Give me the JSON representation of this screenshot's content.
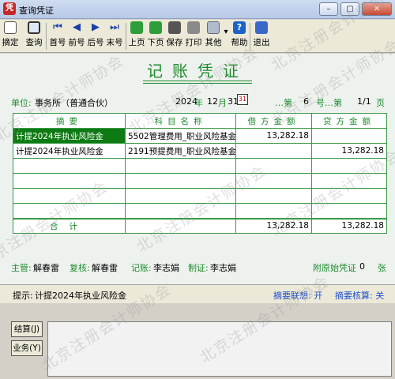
{
  "window": {
    "title": "查询凭证",
    "app_icon": "凭",
    "minimize_icon": "–",
    "maximize_icon": "▢",
    "close_icon": "✕"
  },
  "toolbar": {
    "items": [
      {
        "label": "摘定",
        "icon": "document-icon"
      },
      {
        "label": "查询",
        "icon": "search-icon"
      },
      {
        "label": "首号",
        "icon": "first-icon",
        "glyph": "⏮"
      },
      {
        "label": "前号",
        "icon": "prev-icon",
        "glyph": "◀"
      },
      {
        "label": "后号",
        "icon": "next-icon",
        "glyph": "▶"
      },
      {
        "label": "末号",
        "icon": "last-icon",
        "glyph": "⏭"
      },
      {
        "label": "上页",
        "icon": "page-up-icon"
      },
      {
        "label": "下页",
        "icon": "page-down-icon"
      },
      {
        "label": "保存",
        "icon": "save-icon"
      },
      {
        "label": "打印",
        "icon": "print-icon"
      },
      {
        "label": "其他",
        "icon": "other-icon",
        "dropdown": "▾"
      },
      {
        "label": "帮助",
        "icon": "help-icon",
        "glyph": "?"
      },
      {
        "label": "退出",
        "icon": "exit-icon"
      }
    ]
  },
  "voucher": {
    "title": "记账凭证",
    "unit_label": "单位:",
    "unit_value": "事务所（普通合伙）",
    "year": "2024",
    "year_suffix": "年",
    "month": "12",
    "month_suffix": "月",
    "day": "31",
    "calendar_icon": "31",
    "number_prefix": "…第",
    "number": "6",
    "number_suffix": "号…第",
    "page": "1/1",
    "page_suffix": "页",
    "columns": [
      "摘要",
      "科目名称",
      "借方金额",
      "贷方金额"
    ],
    "rows": [
      {
        "summary": "计提2024年执业风险金",
        "account": "5502管理费用_职业风险基金",
        "debit": "13,282.18",
        "credit": ""
      },
      {
        "summary": "计提2024年执业风险金",
        "account": "2191预提费用_职业风险基金",
        "debit": "",
        "credit": "13,282.18"
      },
      {
        "summary": "",
        "account": "",
        "debit": "",
        "credit": ""
      },
      {
        "summary": "",
        "account": "",
        "debit": "",
        "credit": ""
      },
      {
        "summary": "",
        "account": "",
        "debit": "",
        "credit": ""
      },
      {
        "summary": "",
        "account": "",
        "debit": "",
        "credit": ""
      }
    ],
    "total_label": "合计",
    "total_debit": "13,282.18",
    "total_credit": "13,282.18",
    "signatures": {
      "supervisor_label": "主管:",
      "supervisor": "解春雷",
      "reviewer_label": "复核:",
      "reviewer": "解春雷",
      "bookkeeper_label": "记账:",
      "bookkeeper": "李志娟",
      "preparer_label": "制证:",
      "preparer": "李志娟",
      "attachments_label": "附原始凭证",
      "attachments_count": "0",
      "attachments_unit": "张"
    }
  },
  "hint": {
    "label": "提示:",
    "text": "计提2024年执业风险金",
    "summary_assoc": "摘要联想: 开",
    "summary_check": "摘要核算: 关"
  },
  "bottom": {
    "settle_button": "结算(J)",
    "business_button": "业务(Y)"
  },
  "watermark": "北京注册会计师协会",
  "colors": {
    "accent_green": "#1e8a2e",
    "selected_row": "#0e7a14",
    "link_blue": "#1e50c8"
  }
}
